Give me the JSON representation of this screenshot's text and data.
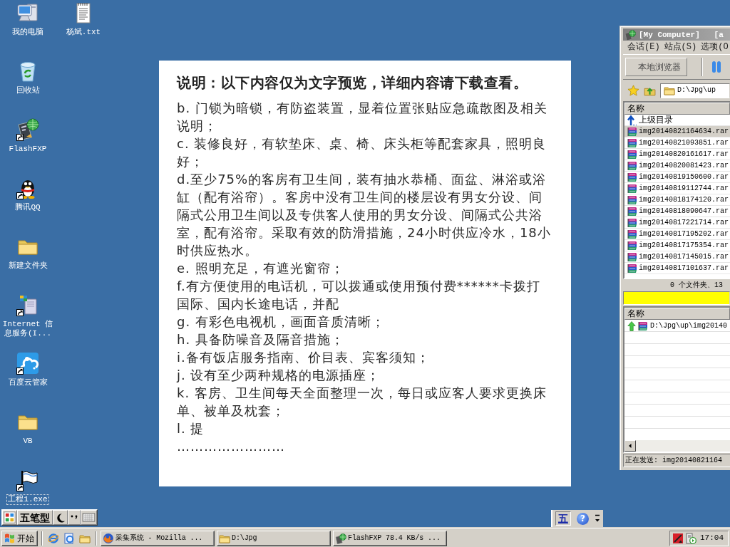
{
  "desktop_icons": [
    {
      "label": "我的电脑",
      "kind": "computer",
      "shortcut": false,
      "focused": false
    },
    {
      "label": "回收站",
      "kind": "recycle_bin",
      "shortcut": false,
      "focused": false
    },
    {
      "label": "FlashFXP",
      "kind": "ftp_client",
      "shortcut": true,
      "focused": false
    },
    {
      "label": "腾讯QQ",
      "kind": "im_client",
      "shortcut": true,
      "focused": false
    },
    {
      "label": "新建文件夹",
      "kind": "folder",
      "shortcut": false,
      "focused": false
    },
    {
      "label": "Internet 信息服务(I...",
      "kind": "web_server",
      "shortcut": true,
      "focused": false
    },
    {
      "label": "百度云管家",
      "kind": "cloud_drive",
      "shortcut": true,
      "focused": false
    },
    {
      "label": "VB",
      "kind": "folder",
      "shortcut": false,
      "focused": false
    },
    {
      "label": "工程1.exe",
      "kind": "executable",
      "shortcut": true,
      "focused": true
    },
    {
      "label": "杨斌.txt",
      "kind": "text_file",
      "shortcut": false,
      "focused": false
    }
  ],
  "document": {
    "heading": "说明：以下内容仅为文字预览，详细内容请下载查看。",
    "paragraphs": [
      "b. 门锁为暗锁，有防盗装置，显着位置张贴应急疏散图及相关说明；",
      "c. 装修良好，有软垫床、桌、椅、床头柜等配套家具，照明良好；",
      "d.至少75%的客房有卫生间，装有抽水恭桶、面盆、淋浴或浴缸（配有浴帘）。客房中没有卫生间的楼层设有男女分设、间隔式公用卫生间以及专供客人使用的男女分设、间隔式公共浴室，配有浴帘。采取有效的防滑措施，24小时供应冷水，18小时供应热水。",
      "e. 照明充足，有遮光窗帘；",
      "f.有方便使用的电话机，可以拨通或使用预付费******卡拨打国际、国内长途电话，并配",
      "g. 有彩色电视机，画面音质清晰；",
      "h. 具备防噪音及隔音措施；",
      "i.备有饭店服务指南、价目表、宾客须知；",
      "j. 设有至少两种规格的电源插座；",
      "k. 客房、卫生间每天全面整理一次，每日或应客人要求更换床单、被单及枕套；",
      "l. 提"
    ],
    "continuation": "……………………"
  },
  "ftp_window": {
    "title": "[My Computer]   [a",
    "menu": [
      "会话(E)",
      "站点(S)",
      "选项(O"
    ],
    "toolbar_button": "本地浏览器",
    "path": "D:\\Jpg\\up",
    "file_list": {
      "column": "名称",
      "rows": [
        {
          "name": "上级目录",
          "kind": "parent",
          "selected": false
        },
        {
          "name": "img20140821164634.rar",
          "kind": "archive",
          "selected": true
        },
        {
          "name": "img20140821093851.rar",
          "kind": "archive",
          "selected": false
        },
        {
          "name": "img20140820161617.rar",
          "kind": "archive",
          "selected": false
        },
        {
          "name": "img20140820081423.rar",
          "kind": "archive",
          "selected": false
        },
        {
          "name": "img20140819150600.rar",
          "kind": "archive",
          "selected": false
        },
        {
          "name": "img20140819112744.rar",
          "kind": "archive",
          "selected": false
        },
        {
          "name": "img20140818174120.rar",
          "kind": "archive",
          "selected": false
        },
        {
          "name": "img20140818090647.rar",
          "kind": "archive",
          "selected": false
        },
        {
          "name": "img20140817221714.rar",
          "kind": "archive",
          "selected": false
        },
        {
          "name": "img20140817195202.rar",
          "kind": "archive",
          "selected": false
        },
        {
          "name": "img20140817175354.rar",
          "kind": "archive",
          "selected": false
        },
        {
          "name": "img20140817145015.rar",
          "kind": "archive",
          "selected": false
        },
        {
          "name": "img20140817101637.rar",
          "kind": "archive",
          "selected": false
        }
      ]
    },
    "summary": "0 个文件夹、13",
    "queue": {
      "column": "名称",
      "rows": [
        {
          "name": "D:\\Jpg\\up\\img20140",
          "kind": "upload"
        }
      ]
    },
    "status_bar": "正在发送: img20140821164"
  },
  "ime_bar": {
    "mode": "五笔型"
  },
  "language_bar": {
    "ime": "五",
    "help": "?"
  },
  "taskbar": {
    "start": "开始",
    "tasks": [
      {
        "label": "采集系统 - Mozilla ...",
        "kind": "browser",
        "selected": false
      },
      {
        "label": "D:\\Jpg",
        "kind": "folder",
        "selected": false
      },
      {
        "label": "FlashFXP 78.4 KB/s ...",
        "kind": "ftp_client",
        "selected": false
      }
    ],
    "clock": "17:04"
  }
}
